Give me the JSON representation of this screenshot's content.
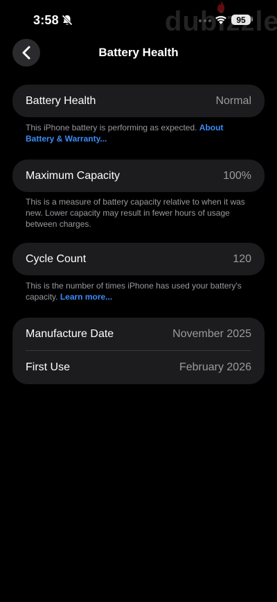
{
  "status_bar": {
    "time": "3:58",
    "battery_level": "95",
    "watermark": "dubizzle"
  },
  "nav": {
    "title": "Battery Health"
  },
  "battery_health": {
    "label": "Battery Health",
    "value": "Normal",
    "footnote_text": "This iPhone battery is performing as expected. ",
    "footnote_link": "About Battery & Warranty..."
  },
  "maximum_capacity": {
    "label": "Maximum Capacity",
    "value": "100%",
    "footnote_text": "This is a measure of battery capacity relative to when it was new. Lower capacity may result in fewer hours of usage between charges."
  },
  "cycle_count": {
    "label": "Cycle Count",
    "value": "120",
    "footnote_text": "This is the number of times iPhone has used your battery's capacity. ",
    "footnote_link": "Learn more..."
  },
  "dates": {
    "manufacture_label": "Manufacture Date",
    "manufacture_value": "November 2025",
    "first_use_label": "First Use",
    "first_use_value": "February 2026"
  },
  "colors": {
    "background": "#000000",
    "card": "#1c1c1e",
    "link": "#3b8cf6",
    "secondary_text": "#9a9aa0"
  }
}
